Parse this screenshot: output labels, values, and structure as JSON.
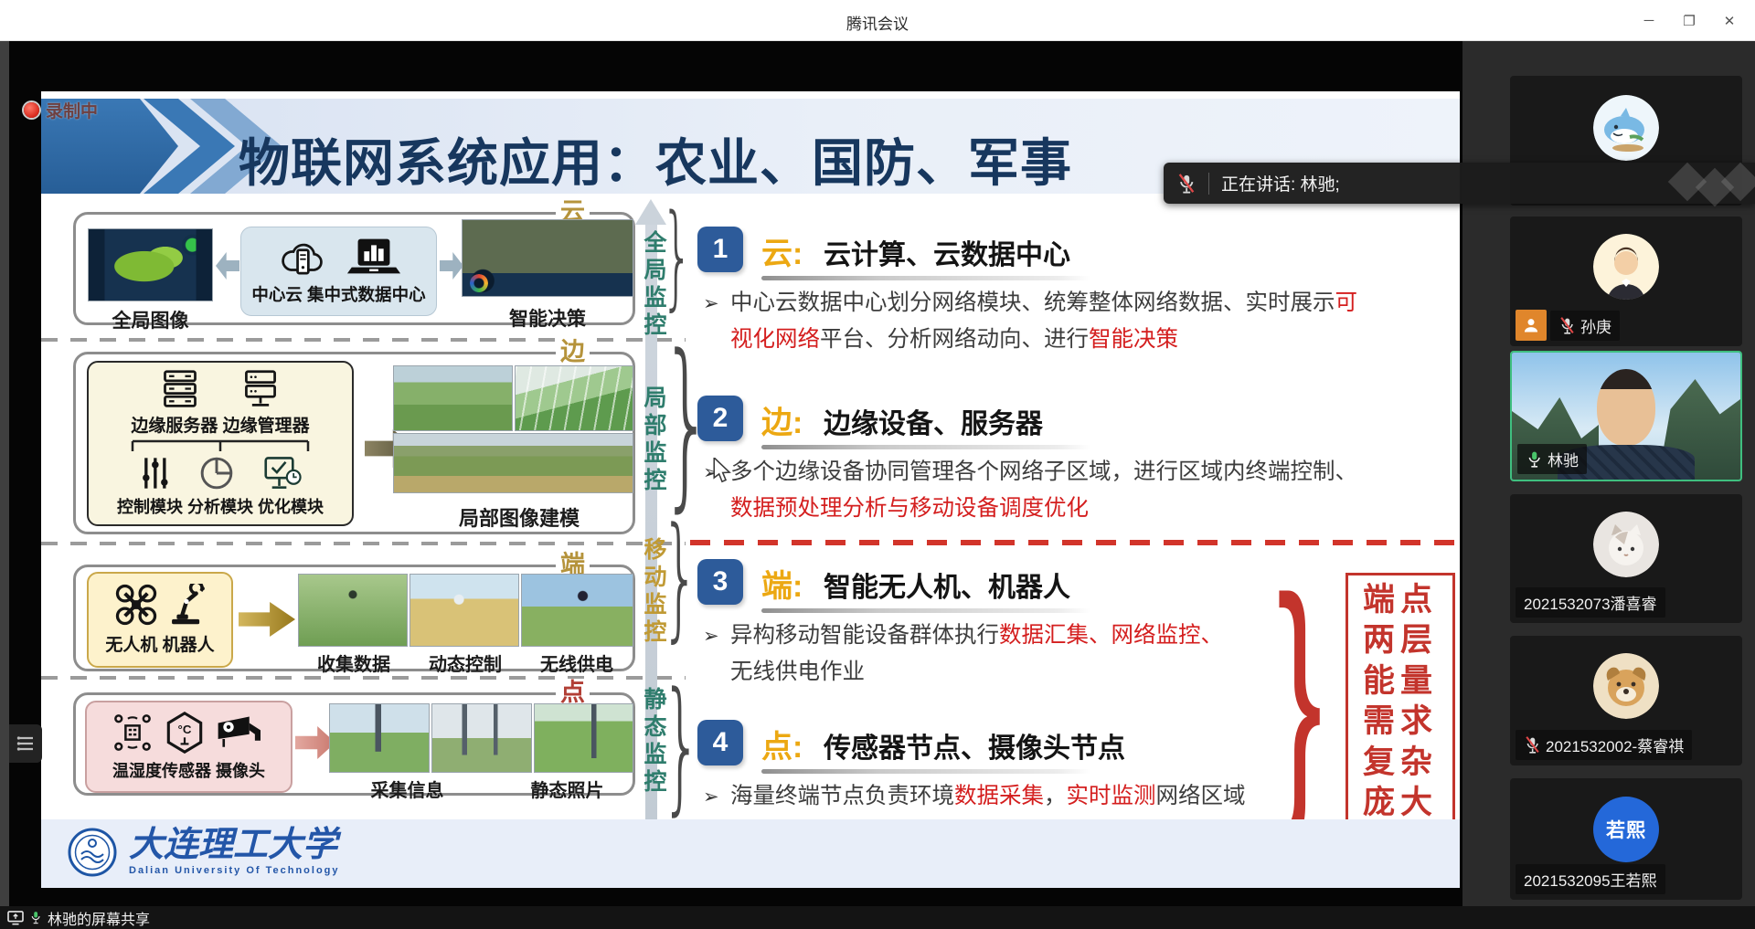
{
  "window": {
    "title": "腾讯会议",
    "minimize_glyph": "─",
    "maximize_glyph": "❐",
    "close_glyph": "✕"
  },
  "recording": {
    "label": "录制中"
  },
  "slide": {
    "title": "物联网系统应用：农业、国防、军事",
    "bullet_marker": "➢",
    "diagram": {
      "cloud": {
        "tag": "云",
        "left_caption": "全局图像",
        "hub_caption": "中心云  集中式数据中心",
        "right_caption": "智能决策"
      },
      "edge": {
        "tag": "边",
        "servers_caption": "边缘服务器  边缘管理器",
        "modules_caption": "控制模块 分析模块 优化模块",
        "right_caption": "局部图像建模"
      },
      "device": {
        "tag": "端",
        "inner_caption": "无人机  机器人",
        "photo_captions": [
          "收集数据",
          "动态控制",
          "无线供电"
        ]
      },
      "node": {
        "tag": "点",
        "inner_caption": "温湿度传感器  摄像头",
        "photo_captions": [
          "采集信息",
          "静态照片"
        ]
      }
    },
    "monitor_axis": [
      {
        "label": "全局监控",
        "color": "#2f7d6d"
      },
      {
        "label": "局部监控",
        "color": "#2f7d6d"
      },
      {
        "label": "移动监控",
        "color": "#c09a35"
      },
      {
        "label": "静态监控",
        "color": "#2f7d6d"
      }
    ],
    "points": [
      {
        "num": "1",
        "key": "云:",
        "heading": "云计算、云数据中心",
        "bullet": [
          {
            "t": "中心云数据中心划分网络模块、统筹整体网络数据、实时展示"
          },
          {
            "t": "可视化网络",
            "red": true
          },
          {
            "t": "平台、分析网络动向、进行"
          },
          {
            "t": "智能决策",
            "red": true
          }
        ]
      },
      {
        "num": "2",
        "key": "边:",
        "heading": "边缘设备、服务器",
        "bullet": [
          {
            "t": "多个边缘设备协同管理各个网络子区域，进行区域内终端控制、"
          },
          {
            "t": "数据预处理分析与移动设备调度优化",
            "red": true
          }
        ]
      },
      {
        "num": "3",
        "key": "端:",
        "heading": "智能无人机、机器人",
        "bullet": [
          {
            "t": "异构移动智能设备群体执行"
          },
          {
            "t": "数据汇集、网络监控、",
            "red": true
          },
          {
            "t": "无线供电作业"
          }
        ]
      },
      {
        "num": "4",
        "key": "点:",
        "heading": "传感器节点、摄像头节点",
        "bullet": [
          {
            "t": "海量终端节点负责环境"
          },
          {
            "t": "数据采集",
            "red": true
          },
          {
            "t": "，"
          },
          {
            "t": "实时监测",
            "red": true
          },
          {
            "t": "网络区域"
          }
        ]
      }
    ],
    "side_note_rows": [
      "端点",
      "两层",
      "能量",
      "需求",
      "复杂",
      "庞大"
    ],
    "footer": {
      "university_zh": "大连理工大学",
      "university_en": "Dalian University Of Technology"
    }
  },
  "toast": {
    "speaking": "正在讲话: 林驰;"
  },
  "participants": [
    {
      "avatar": "shark"
    },
    {
      "label": "孙庚",
      "avatar": "man",
      "muted": true,
      "host_badge": true
    },
    {
      "label": "林驰",
      "avatar": "video",
      "active": true
    },
    {
      "label": "2021532073潘喜睿",
      "avatar": "cat"
    },
    {
      "label": "2021532002-蔡睿祺",
      "avatar": "dog",
      "muted": true
    },
    {
      "label": "2021532095王若熙",
      "avatar": "blue",
      "avatar_text": "若熙"
    }
  ],
  "status_bar": {
    "share_label": "林驰的屏幕共享"
  },
  "colors": {
    "accent_blue": "#2d5b9a",
    "gold": "#eca812",
    "red": "#d41e1e",
    "active_green": "#3fbf7f",
    "brace_red": "#c3342c"
  }
}
